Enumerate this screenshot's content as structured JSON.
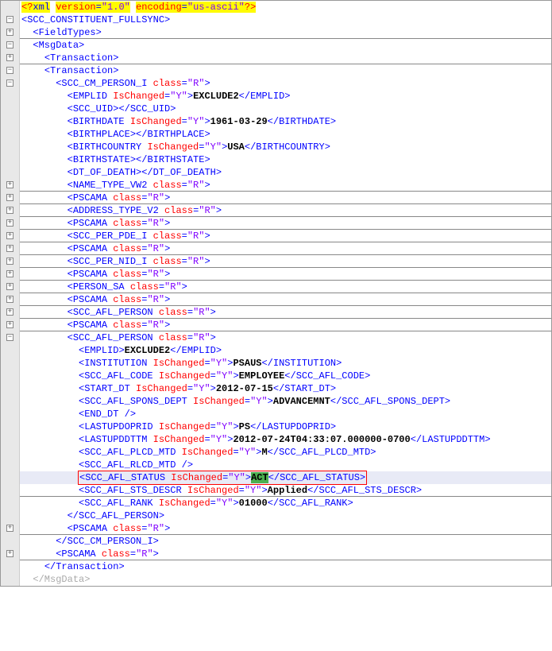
{
  "declaration": {
    "pi_open": "<?",
    "xml": "xml",
    "attr1_name": "version",
    "attr1_val": "\"1.0\"",
    "attr2_name": "encoding",
    "attr2_val": "\"us-ascii\"",
    "pi_close": "?>"
  },
  "lines": [
    {
      "indent": 0,
      "type": "open",
      "tag": "SCC_CONSTITUENT_FULLSYNC",
      "fold": "-",
      "hr": false
    },
    {
      "indent": 1,
      "type": "self",
      "tag": "FieldTypes",
      "fold": "+",
      "hr": true
    },
    {
      "indent": 1,
      "type": "open",
      "tag": "MsgData",
      "fold": "-",
      "hr": false
    },
    {
      "indent": 2,
      "type": "self",
      "tag": "Transaction",
      "fold": "+",
      "hr": true
    },
    {
      "indent": 2,
      "type": "open",
      "tag": "Transaction",
      "fold": "-",
      "hr": false
    },
    {
      "indent": 3,
      "type": "open",
      "tag": "SCC_CM_PERSON_I",
      "attrs": [
        [
          "class",
          "\"R\""
        ]
      ],
      "fold": "-",
      "hr": false
    },
    {
      "indent": 4,
      "type": "full",
      "tag": "EMPLID",
      "attrs": [
        [
          "IsChanged",
          "\"Y\""
        ]
      ],
      "content": "EXCLUDE2",
      "fold": "",
      "hr": false
    },
    {
      "indent": 4,
      "type": "full",
      "tag": "SCC_UID",
      "content": "",
      "fold": "",
      "hr": false
    },
    {
      "indent": 4,
      "type": "full",
      "tag": "BIRTHDATE",
      "attrs": [
        [
          "IsChanged",
          "\"Y\""
        ]
      ],
      "content": "1961-03-29",
      "fold": "",
      "hr": false
    },
    {
      "indent": 4,
      "type": "full",
      "tag": "BIRTHPLACE",
      "content": "",
      "fold": "",
      "hr": false
    },
    {
      "indent": 4,
      "type": "full",
      "tag": "BIRTHCOUNTRY",
      "attrs": [
        [
          "IsChanged",
          "\"Y\""
        ]
      ],
      "content": "USA",
      "fold": "",
      "hr": false
    },
    {
      "indent": 4,
      "type": "full",
      "tag": "BIRTHSTATE",
      "content": "",
      "fold": "",
      "hr": false
    },
    {
      "indent": 4,
      "type": "full",
      "tag": "DT_OF_DEATH",
      "content": "",
      "fold": "",
      "hr": false
    },
    {
      "indent": 4,
      "type": "self",
      "tag": "NAME_TYPE_VW2",
      "attrs": [
        [
          "class",
          "\"R\""
        ]
      ],
      "fold": "+",
      "hr": true
    },
    {
      "indent": 4,
      "type": "self",
      "tag": "PSCAMA",
      "attrs": [
        [
          "class",
          "\"R\""
        ]
      ],
      "fold": "+",
      "hr": true
    },
    {
      "indent": 4,
      "type": "self",
      "tag": "ADDRESS_TYPE_V2",
      "attrs": [
        [
          "class",
          "\"R\""
        ]
      ],
      "fold": "+",
      "hr": true
    },
    {
      "indent": 4,
      "type": "self",
      "tag": "PSCAMA",
      "attrs": [
        [
          "class",
          "\"R\""
        ]
      ],
      "fold": "+",
      "hr": true
    },
    {
      "indent": 4,
      "type": "self",
      "tag": "SCC_PER_PDE_I",
      "attrs": [
        [
          "class",
          "\"R\""
        ]
      ],
      "fold": "+",
      "hr": true
    },
    {
      "indent": 4,
      "type": "self",
      "tag": "PSCAMA",
      "attrs": [
        [
          "class",
          "\"R\""
        ]
      ],
      "fold": "+",
      "hr": true
    },
    {
      "indent": 4,
      "type": "self",
      "tag": "SCC_PER_NID_I",
      "attrs": [
        [
          "class",
          "\"R\""
        ]
      ],
      "fold": "+",
      "hr": true
    },
    {
      "indent": 4,
      "type": "self",
      "tag": "PSCAMA",
      "attrs": [
        [
          "class",
          "\"R\""
        ]
      ],
      "fold": "+",
      "hr": true
    },
    {
      "indent": 4,
      "type": "self",
      "tag": "PERSON_SA",
      "attrs": [
        [
          "class",
          "\"R\""
        ]
      ],
      "fold": "+",
      "hr": true
    },
    {
      "indent": 4,
      "type": "self",
      "tag": "PSCAMA",
      "attrs": [
        [
          "class",
          "\"R\""
        ]
      ],
      "fold": "+",
      "hr": true
    },
    {
      "indent": 4,
      "type": "self",
      "tag": "SCC_AFL_PERSON",
      "attrs": [
        [
          "class",
          "\"R\""
        ]
      ],
      "fold": "+",
      "hr": true
    },
    {
      "indent": 4,
      "type": "self",
      "tag": "PSCAMA",
      "attrs": [
        [
          "class",
          "\"R\""
        ]
      ],
      "fold": "+",
      "hr": true
    },
    {
      "indent": 4,
      "type": "open",
      "tag": "SCC_AFL_PERSON",
      "attrs": [
        [
          "class",
          "\"R\""
        ]
      ],
      "fold": "-",
      "hr": false
    },
    {
      "indent": 5,
      "type": "full",
      "tag": "EMPLID",
      "content": "EXCLUDE2",
      "fold": "",
      "hr": false
    },
    {
      "indent": 5,
      "type": "full",
      "tag": "INSTITUTION",
      "attrs": [
        [
          "IsChanged",
          "\"Y\""
        ]
      ],
      "content": "PSAUS",
      "fold": "",
      "hr": false
    },
    {
      "indent": 5,
      "type": "full",
      "tag": "SCC_AFL_CODE",
      "attrs": [
        [
          "IsChanged",
          "\"Y\""
        ]
      ],
      "content": "EMPLOYEE",
      "fold": "",
      "hr": false
    },
    {
      "indent": 5,
      "type": "full",
      "tag": "START_DT",
      "attrs": [
        [
          "IsChanged",
          "\"Y\""
        ]
      ],
      "content": "2012-07-15",
      "fold": "",
      "hr": false
    },
    {
      "indent": 5,
      "type": "full",
      "tag": "SCC_AFL_SPONS_DEPT",
      "attrs": [
        [
          "IsChanged",
          "\"Y\""
        ]
      ],
      "content": "ADVANCEMNT",
      "fold": "",
      "hr": false
    },
    {
      "indent": 5,
      "type": "empty",
      "tag": "END_DT",
      "fold": "",
      "hr": false
    },
    {
      "indent": 5,
      "type": "full",
      "tag": "LASTUPDOPRID",
      "attrs": [
        [
          "IsChanged",
          "\"Y\""
        ]
      ],
      "content": "PS",
      "fold": "",
      "hr": false
    },
    {
      "indent": 5,
      "type": "full",
      "tag": "LASTUPDDTTM",
      "attrs": [
        [
          "IsChanged",
          "\"Y\""
        ]
      ],
      "content": "2012-07-24T04:33:07.000000-0700",
      "fold": "",
      "hr": false
    },
    {
      "indent": 5,
      "type": "full",
      "tag": "SCC_AFL_PLCD_MTD",
      "attrs": [
        [
          "IsChanged",
          "\"Y\""
        ]
      ],
      "content": "M",
      "fold": "",
      "hr": false
    },
    {
      "indent": 5,
      "type": "empty",
      "tag": "SCC_AFL_RLCD_MTD",
      "fold": "",
      "hr": false
    },
    {
      "indent": 5,
      "type": "full",
      "tag": "SCC_AFL_STATUS",
      "attrs": [
        [
          "IsChanged",
          "\"Y\""
        ]
      ],
      "content": "ACT",
      "fold": "",
      "hr": false,
      "highlight": true,
      "redbox": true,
      "greenContent": true
    },
    {
      "indent": 5,
      "type": "full",
      "tag": "SCC_AFL_STS_DESCR",
      "attrs": [
        [
          "IsChanged",
          "\"Y\""
        ]
      ],
      "content": "Applied",
      "fold": "",
      "hr": true
    },
    {
      "indent": 5,
      "type": "full",
      "tag": "SCC_AFL_RANK",
      "attrs": [
        [
          "IsChanged",
          "\"Y\""
        ]
      ],
      "content": "01000",
      "fold": "",
      "hr": false
    },
    {
      "indent": 4,
      "type": "close",
      "tag": "SCC_AFL_PERSON",
      "fold": "",
      "hr": false
    },
    {
      "indent": 4,
      "type": "self",
      "tag": "PSCAMA",
      "attrs": [
        [
          "class",
          "\"R\""
        ]
      ],
      "fold": "+",
      "hr": true
    },
    {
      "indent": 3,
      "type": "close",
      "tag": "SCC_CM_PERSON_I",
      "fold": "",
      "hr": false
    },
    {
      "indent": 3,
      "type": "self",
      "tag": "PSCAMA",
      "attrs": [
        [
          "class",
          "\"R\""
        ]
      ],
      "fold": "+",
      "hr": true
    },
    {
      "indent": 2,
      "type": "close",
      "tag": "Transaction",
      "fold": "",
      "hr": false
    },
    {
      "indent": 1,
      "type": "close_dim",
      "tag": "MsgData",
      "fold": "",
      "hr": false
    }
  ]
}
